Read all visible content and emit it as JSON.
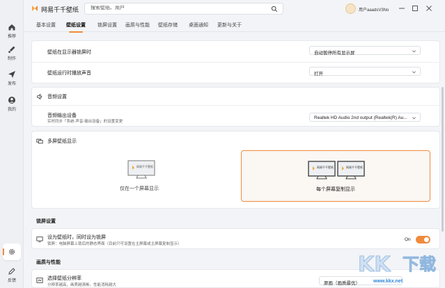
{
  "app": {
    "name": "网易千千壁纸"
  },
  "search": {
    "placeholder": "搜索壁纸、用户"
  },
  "user": {
    "name": "用户aaadsV3No"
  },
  "rail": [
    {
      "label": "推荐",
      "icon": "home-icon"
    },
    {
      "label": "制作",
      "icon": "brush-icon"
    },
    {
      "label": "发布",
      "icon": "send-icon"
    },
    {
      "label": "我的",
      "icon": "user-icon"
    }
  ],
  "rail_bottom": {
    "feedback": "反馈"
  },
  "tabs": [
    "基本设置",
    "壁纸设置",
    "锁屏设置",
    "画质与性能",
    "壁纸存储",
    "桌面通知",
    "更新与关于"
  ],
  "active_tab": "壁纸设置",
  "wallpaper": {
    "lock_label": "壁纸在显示器锁屏时",
    "lock_value": "自动暂停所有显示屏",
    "sound_label": "壁纸运行时播放声音",
    "sound_value": "打开"
  },
  "audio": {
    "title": "音频设置",
    "output_label": "音频输出设备",
    "output_sub": "实时同步「系统-声音-输出设备」的设置变更",
    "output_value": "Realtek HD Audio 2nd output (Realtek(R) Au..."
  },
  "multi": {
    "title": "多屏壁纸显示",
    "screen_brand": "网易千千壁纸",
    "option_single": "仅在一个屏幕显示",
    "option_copy": "每个屏幕复制显示",
    "selected": "每个屏幕复制显示"
  },
  "lockscreen": {
    "section": "锁屏设置",
    "label": "设为壁纸时，同时设为锁屏",
    "sub": "锁屏：电脑屏幕上锁后的静态界面（目前只可设置在主屏幕或主屏幕复制显示）",
    "toggle_text": "On",
    "toggle_on": true
  },
  "quality": {
    "section": "画质与性能",
    "label": "选择壁纸分辨率",
    "sub": "分辨率越高，画质越清晰，性能消耗越大",
    "value": "原画（画质最优）"
  },
  "watermark": {
    "text": "www.kkx.net"
  },
  "colors": {
    "accent": "#f08a3c",
    "card": "#ffffff",
    "background": "#f3f4f7"
  }
}
